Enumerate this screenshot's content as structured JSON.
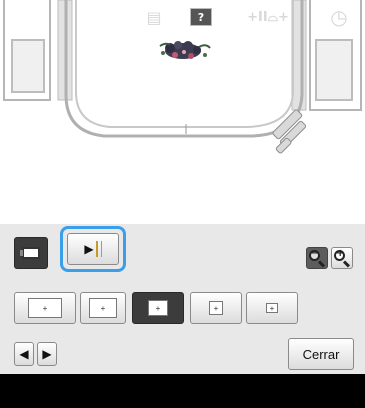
{
  "toolbar": {
    "frame_view_icon": "embroidery-frame-icon",
    "trial_button": {
      "icon_name": "play-needle-icon",
      "glyph": "▶",
      "highlight_color": "#3a9ee8"
    },
    "zoom_out": {
      "icon_name": "zoom-out-icon",
      "glyph": "−"
    },
    "zoom_in": {
      "icon_name": "zoom-in-icon",
      "glyph": "+"
    }
  },
  "frame_sizes": [
    {
      "name": "frame-size-1",
      "glyph": "+",
      "selected": false
    },
    {
      "name": "frame-size-2",
      "glyph": "+",
      "selected": false
    },
    {
      "name": "frame-size-3",
      "glyph": "+",
      "selected": true
    },
    {
      "name": "frame-size-4",
      "glyph": "+",
      "selected": false
    },
    {
      "name": "frame-size-5",
      "glyph": "+",
      "selected": false
    }
  ],
  "nav": {
    "prev_glyph": "◀",
    "next_glyph": "▶",
    "close_label": "Cerrar"
  },
  "bottom_bar": {
    "background": "#000000",
    "icons": [
      {
        "name": "page-icon",
        "glyph": "▤"
      },
      {
        "name": "help-icon",
        "glyph": "?"
      },
      {
        "name": "presser-foot-icon",
        "glyph": "+II⌓+"
      },
      {
        "name": "clock-icon",
        "glyph": "◷"
      }
    ]
  }
}
